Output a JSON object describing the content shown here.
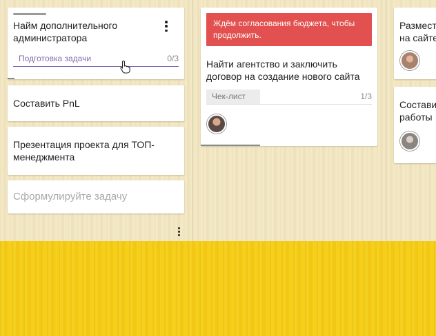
{
  "column1": {
    "card1": {
      "title": "Найм дополнительного администратора",
      "checklist_label": "Подготовка задачи",
      "checklist_count": "0/3"
    },
    "card2": {
      "title": "Составить PnL"
    },
    "card3": {
      "title": "Презентация проекта для ТОП-менеджмента"
    },
    "new_task_placeholder": "Сформулируйте задачу"
  },
  "column2": {
    "card1": {
      "banner": "Ждём согласования бюджета, чтобы продолжить.",
      "title": "Найти агентство и заключить договор на создание нового сайта",
      "checklist_label": "Чек-лист",
      "checklist_count": "1/3"
    }
  },
  "column3": {
    "card1": {
      "title": "Размест на сайте"
    },
    "card2": {
      "title": "Состави работы"
    }
  },
  "colors": {
    "banner": "#e25050",
    "checklist_accent": "#7b5ca3",
    "board": "#f3e7c2",
    "floor": "#f6cd15"
  },
  "icons": [
    "more-vert-icon",
    "hand-pointer-icon",
    "avatar-icon"
  ]
}
